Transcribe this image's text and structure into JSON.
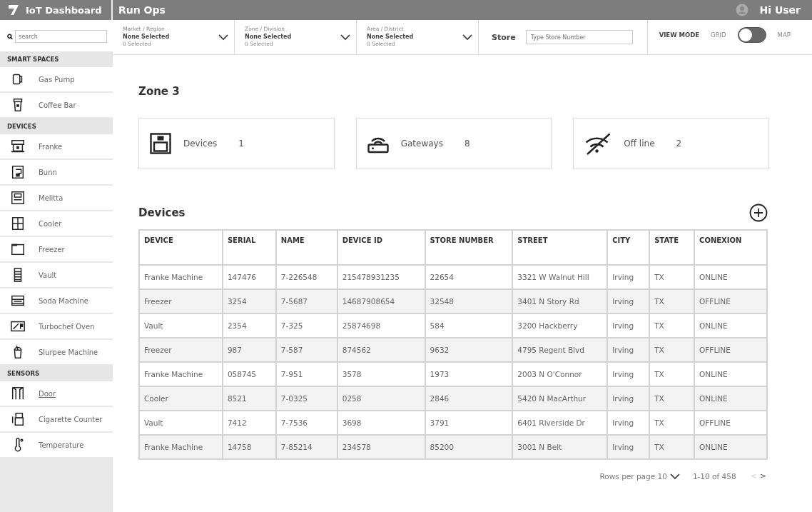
{
  "app": {
    "title": "IoT Dashboard"
  },
  "header": {
    "title": "Run Ops",
    "greeting": "Hi User"
  },
  "sidebar": {
    "search": {
      "placeholder": "search"
    },
    "sections": [
      {
        "title": "SMART SPACES",
        "items": [
          {
            "label": "Gas Pump",
            "selected": false
          },
          {
            "label": "Coffee Bar",
            "selected": false
          }
        ]
      },
      {
        "title": "DEVICES",
        "items": [
          {
            "label": "Franke",
            "selected": false
          },
          {
            "label": "Bunn",
            "selected": false
          },
          {
            "label": "Melitta",
            "selected": false
          },
          {
            "label": "Cooler",
            "selected": false
          },
          {
            "label": "Freezer",
            "selected": false
          },
          {
            "label": "Vault",
            "selected": false
          },
          {
            "label": "Soda Machine",
            "selected": false
          },
          {
            "label": "Turbochef Oven",
            "selected": false
          },
          {
            "label": "Slurpee Machine",
            "selected": false
          }
        ]
      },
      {
        "title": "SENSORS",
        "items": [
          {
            "label": "Door",
            "selected": true
          },
          {
            "label": "Cigarette Counter",
            "selected": false
          },
          {
            "label": "Temperature",
            "selected": false
          }
        ]
      }
    ]
  },
  "filters": [
    {
      "label": "Market / Region",
      "value": "None Selected",
      "count": "0 Selected"
    },
    {
      "label": "Zone / Division",
      "value": "None Selected",
      "count": "0 Selected"
    },
    {
      "label": "Area / District",
      "value": "None Selected",
      "count": "0 Selected"
    }
  ],
  "store": {
    "label": "Store",
    "placeholder": "Type Store Number"
  },
  "view_mode": {
    "label": "VIEW MODE",
    "left": "GRID",
    "right": "MAP",
    "on": false
  },
  "zone_title": "Zone 3",
  "stats": [
    {
      "label": "Devices",
      "value": "1"
    },
    {
      "label": "Gateways",
      "value": "8"
    },
    {
      "label": "Off line",
      "value": "2"
    }
  ],
  "devices": {
    "title": "Devices",
    "columns": [
      "DEVICE",
      "SERIAL",
      "NAME",
      "DEVICE ID",
      "STORE NUMBER",
      "STREET",
      "CITY",
      "STATE",
      "CONEXION"
    ],
    "rows": [
      [
        "Franke Machine",
        "147476",
        "7-226548",
        "215478931235",
        "22654",
        "3321 W Walnut Hill",
        "Irving",
        "TX",
        "ONLINE"
      ],
      [
        "Freezer",
        "3254",
        "7-5687",
        "14687908654",
        "32548",
        "3401 N Story Rd",
        "Irving",
        "TX",
        "OFFLINE"
      ],
      [
        "Vault",
        "2354",
        "7-325",
        "25874698",
        "584",
        "3200 Hackberry",
        "Irving",
        "TX",
        "ONLINE"
      ],
      [
        "Freezer",
        "987",
        "7-587",
        "874562",
        "9632",
        "4795 Regent Blvd",
        "Irving",
        "TX",
        "OFFLINE"
      ],
      [
        "Franke Machine",
        "058745",
        "7-951",
        "3578",
        "1973",
        "2003 N O'Connor",
        "Irving",
        "TX",
        "ONLINE"
      ],
      [
        "Cooler",
        "8521",
        "7-0325",
        "0258",
        "2846",
        "5420 N MacArthur",
        "Irving",
        "TX",
        "ONLINE"
      ],
      [
        "Vault",
        "7412",
        "7-7536",
        "3698",
        "3791",
        "6401 Riverside Dr",
        "Irving",
        "TX",
        "OFFLINE"
      ],
      [
        "Franke Machine",
        "14758",
        "7-85214",
        "234578",
        "85200",
        "3001 N Belt",
        "Irving",
        "TX",
        "ONLINE"
      ]
    ]
  },
  "pagination": {
    "rows_label": "Rows per page 10",
    "range": "1-10 of 458",
    "prev": {
      "label": "<",
      "disabled": true
    },
    "next": {
      "label": ">",
      "disabled": false
    }
  }
}
